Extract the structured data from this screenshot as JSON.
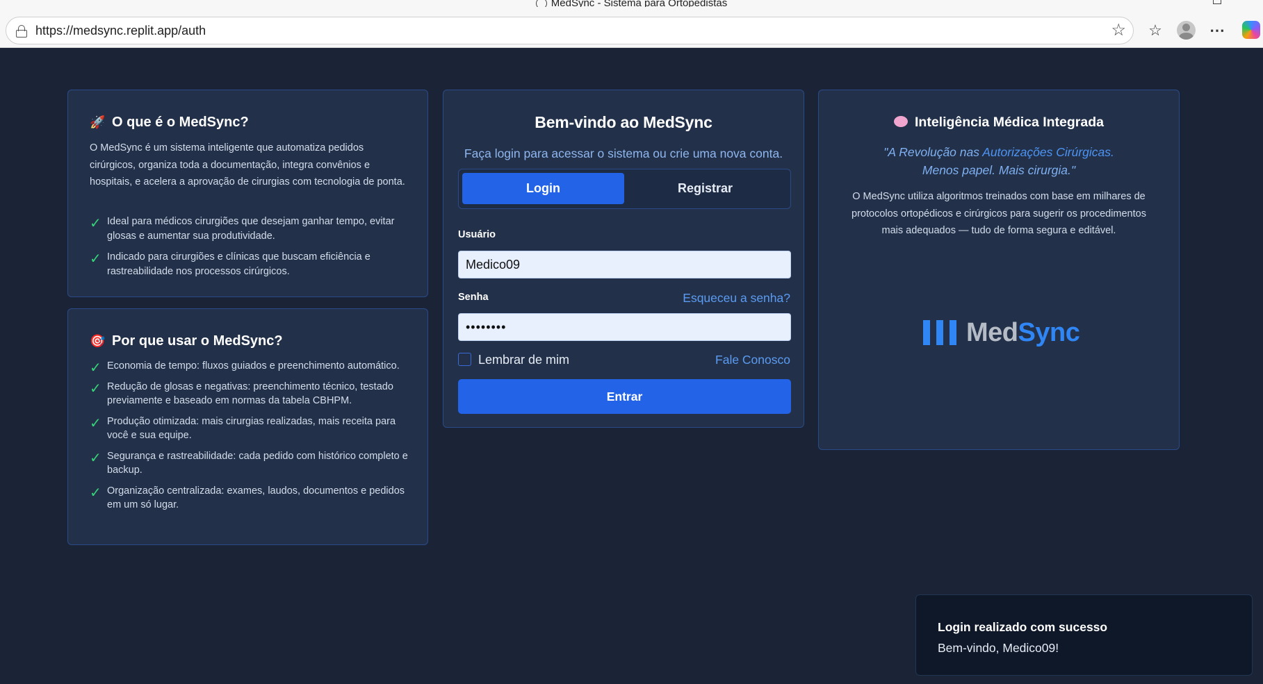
{
  "browser": {
    "window_title": "MedSync - Sistema para Ortopedistas",
    "url": "https://medsync.replit.app/auth"
  },
  "what_is": {
    "emoji": "🚀",
    "title": "O que é o MedSync?",
    "lead": "O MedSync é um sistema inteligente que automatiza pedidos cirúrgicos, organiza toda a documentação, integra convênios e hospitais, e acelera a aprovação de cirurgias com tecnologia de ponta.",
    "items": [
      "Ideal para médicos cirurgiões que desejam ganhar tempo, evitar glosas e aumentar sua produtividade.",
      "Indicado para cirurgiões e clínicas que buscam eficiência e rastreabilidade nos processos cirúrgicos."
    ]
  },
  "why_use": {
    "emoji": "🎯",
    "title": "Por que usar o MedSync?",
    "items": [
      "Economia de tempo: fluxos guiados e preenchimento automático.",
      "Redução de glosas e negativas: preenchimento técnico, testado previamente e baseado em normas da tabela CBHPM.",
      "Produção otimizada: mais cirurgias realizadas, mais receita para você e sua equipe.",
      "Segurança e rastreabilidade: cada pedido com histórico completo e backup.",
      "Organização centralizada: exames, laudos, documentos e pedidos em um só lugar."
    ]
  },
  "login": {
    "title": "Bem-vindo ao MedSync",
    "subtitle": "Faça login para acessar o sistema ou crie uma nova conta.",
    "tab_login": "Login",
    "tab_register": "Registrar",
    "user_label": "Usuário",
    "user_value": "Medico09",
    "password_label": "Senha",
    "forgot": "Esqueceu a senha?",
    "password_value": "••••••••",
    "remember": "Lembrar de mim",
    "contact": "Fale Conosco",
    "submit": "Entrar"
  },
  "ai": {
    "title": "Inteligência Médica Integrada",
    "quote_a": "\"A Revolução nas ",
    "quote_highlight": "Autorizações Cirúrgicas.",
    "quote_b": "Menos papel. Mais cirurgia.\"",
    "description": "O MedSync utiliza algoritmos treinados com base em milhares de protocolos ortopédicos e cirúrgicos para sugerir os procedimentos mais adequados — tudo de forma segura e editável.",
    "logo_med": "Med",
    "logo_sync": "Sync"
  },
  "toast": {
    "title": "Login realizado com sucesso",
    "message": "Bem-vindo, Medico09!"
  },
  "colors": {
    "background": "#1a2436",
    "card": "#223149",
    "accent": "#2363e8",
    "check": "#38d27a",
    "link": "#5b9bf2"
  }
}
